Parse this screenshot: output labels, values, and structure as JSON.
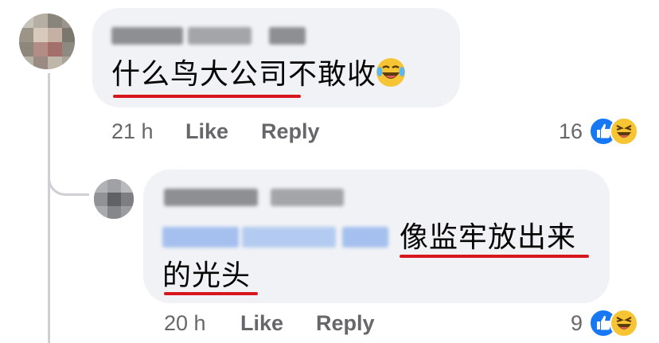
{
  "comment1": {
    "time": "21 h",
    "like_label": "Like",
    "reply_label": "Reply",
    "text_underlined": "什么鸟大公司",
    "text_rest": "不敢收",
    "reaction_count": "16"
  },
  "reply1": {
    "time": "20 h",
    "like_label": "Like",
    "reply_label": "Reply",
    "text_line1": "像监牢放出来",
    "text_line2": "的光头",
    "reaction_count": "9"
  },
  "colors": {
    "bubble": "#f0f2f5",
    "meta_text": "#65676b",
    "underline": "#d8161e",
    "link_blue": "#1877f2"
  }
}
